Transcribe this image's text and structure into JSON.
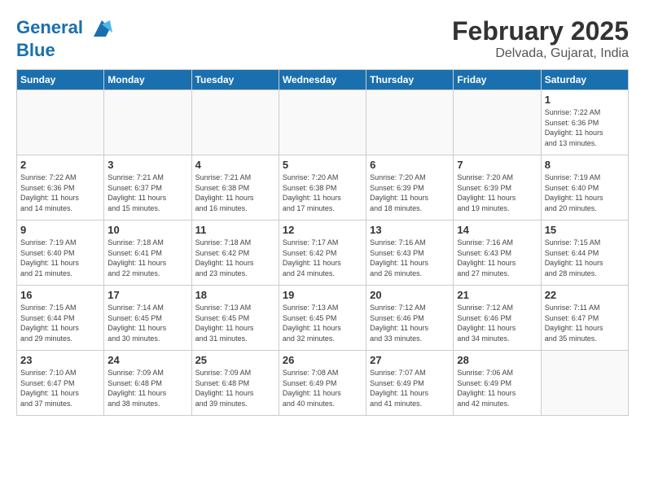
{
  "header": {
    "logo_line1": "General",
    "logo_line2": "Blue",
    "month": "February 2025",
    "location": "Delvada, Gujarat, India"
  },
  "weekdays": [
    "Sunday",
    "Monday",
    "Tuesday",
    "Wednesday",
    "Thursday",
    "Friday",
    "Saturday"
  ],
  "weeks": [
    [
      {
        "day": "",
        "info": ""
      },
      {
        "day": "",
        "info": ""
      },
      {
        "day": "",
        "info": ""
      },
      {
        "day": "",
        "info": ""
      },
      {
        "day": "",
        "info": ""
      },
      {
        "day": "",
        "info": ""
      },
      {
        "day": "1",
        "info": "Sunrise: 7:22 AM\nSunset: 6:36 PM\nDaylight: 11 hours\nand 13 minutes."
      }
    ],
    [
      {
        "day": "2",
        "info": "Sunrise: 7:22 AM\nSunset: 6:36 PM\nDaylight: 11 hours\nand 14 minutes."
      },
      {
        "day": "3",
        "info": "Sunrise: 7:21 AM\nSunset: 6:37 PM\nDaylight: 11 hours\nand 15 minutes."
      },
      {
        "day": "4",
        "info": "Sunrise: 7:21 AM\nSunset: 6:38 PM\nDaylight: 11 hours\nand 16 minutes."
      },
      {
        "day": "5",
        "info": "Sunrise: 7:20 AM\nSunset: 6:38 PM\nDaylight: 11 hours\nand 17 minutes."
      },
      {
        "day": "6",
        "info": "Sunrise: 7:20 AM\nSunset: 6:39 PM\nDaylight: 11 hours\nand 18 minutes."
      },
      {
        "day": "7",
        "info": "Sunrise: 7:20 AM\nSunset: 6:39 PM\nDaylight: 11 hours\nand 19 minutes."
      },
      {
        "day": "8",
        "info": "Sunrise: 7:19 AM\nSunset: 6:40 PM\nDaylight: 11 hours\nand 20 minutes."
      }
    ],
    [
      {
        "day": "9",
        "info": "Sunrise: 7:19 AM\nSunset: 6:40 PM\nDaylight: 11 hours\nand 21 minutes."
      },
      {
        "day": "10",
        "info": "Sunrise: 7:18 AM\nSunset: 6:41 PM\nDaylight: 11 hours\nand 22 minutes."
      },
      {
        "day": "11",
        "info": "Sunrise: 7:18 AM\nSunset: 6:42 PM\nDaylight: 11 hours\nand 23 minutes."
      },
      {
        "day": "12",
        "info": "Sunrise: 7:17 AM\nSunset: 6:42 PM\nDaylight: 11 hours\nand 24 minutes."
      },
      {
        "day": "13",
        "info": "Sunrise: 7:16 AM\nSunset: 6:43 PM\nDaylight: 11 hours\nand 26 minutes."
      },
      {
        "day": "14",
        "info": "Sunrise: 7:16 AM\nSunset: 6:43 PM\nDaylight: 11 hours\nand 27 minutes."
      },
      {
        "day": "15",
        "info": "Sunrise: 7:15 AM\nSunset: 6:44 PM\nDaylight: 11 hours\nand 28 minutes."
      }
    ],
    [
      {
        "day": "16",
        "info": "Sunrise: 7:15 AM\nSunset: 6:44 PM\nDaylight: 11 hours\nand 29 minutes."
      },
      {
        "day": "17",
        "info": "Sunrise: 7:14 AM\nSunset: 6:45 PM\nDaylight: 11 hours\nand 30 minutes."
      },
      {
        "day": "18",
        "info": "Sunrise: 7:13 AM\nSunset: 6:45 PM\nDaylight: 11 hours\nand 31 minutes."
      },
      {
        "day": "19",
        "info": "Sunrise: 7:13 AM\nSunset: 6:45 PM\nDaylight: 11 hours\nand 32 minutes."
      },
      {
        "day": "20",
        "info": "Sunrise: 7:12 AM\nSunset: 6:46 PM\nDaylight: 11 hours\nand 33 minutes."
      },
      {
        "day": "21",
        "info": "Sunrise: 7:12 AM\nSunset: 6:46 PM\nDaylight: 11 hours\nand 34 minutes."
      },
      {
        "day": "22",
        "info": "Sunrise: 7:11 AM\nSunset: 6:47 PM\nDaylight: 11 hours\nand 35 minutes."
      }
    ],
    [
      {
        "day": "23",
        "info": "Sunrise: 7:10 AM\nSunset: 6:47 PM\nDaylight: 11 hours\nand 37 minutes."
      },
      {
        "day": "24",
        "info": "Sunrise: 7:09 AM\nSunset: 6:48 PM\nDaylight: 11 hours\nand 38 minutes."
      },
      {
        "day": "25",
        "info": "Sunrise: 7:09 AM\nSunset: 6:48 PM\nDaylight: 11 hours\nand 39 minutes."
      },
      {
        "day": "26",
        "info": "Sunrise: 7:08 AM\nSunset: 6:49 PM\nDaylight: 11 hours\nand 40 minutes."
      },
      {
        "day": "27",
        "info": "Sunrise: 7:07 AM\nSunset: 6:49 PM\nDaylight: 11 hours\nand 41 minutes."
      },
      {
        "day": "28",
        "info": "Sunrise: 7:06 AM\nSunset: 6:49 PM\nDaylight: 11 hours\nand 42 minutes."
      },
      {
        "day": "",
        "info": ""
      }
    ]
  ]
}
